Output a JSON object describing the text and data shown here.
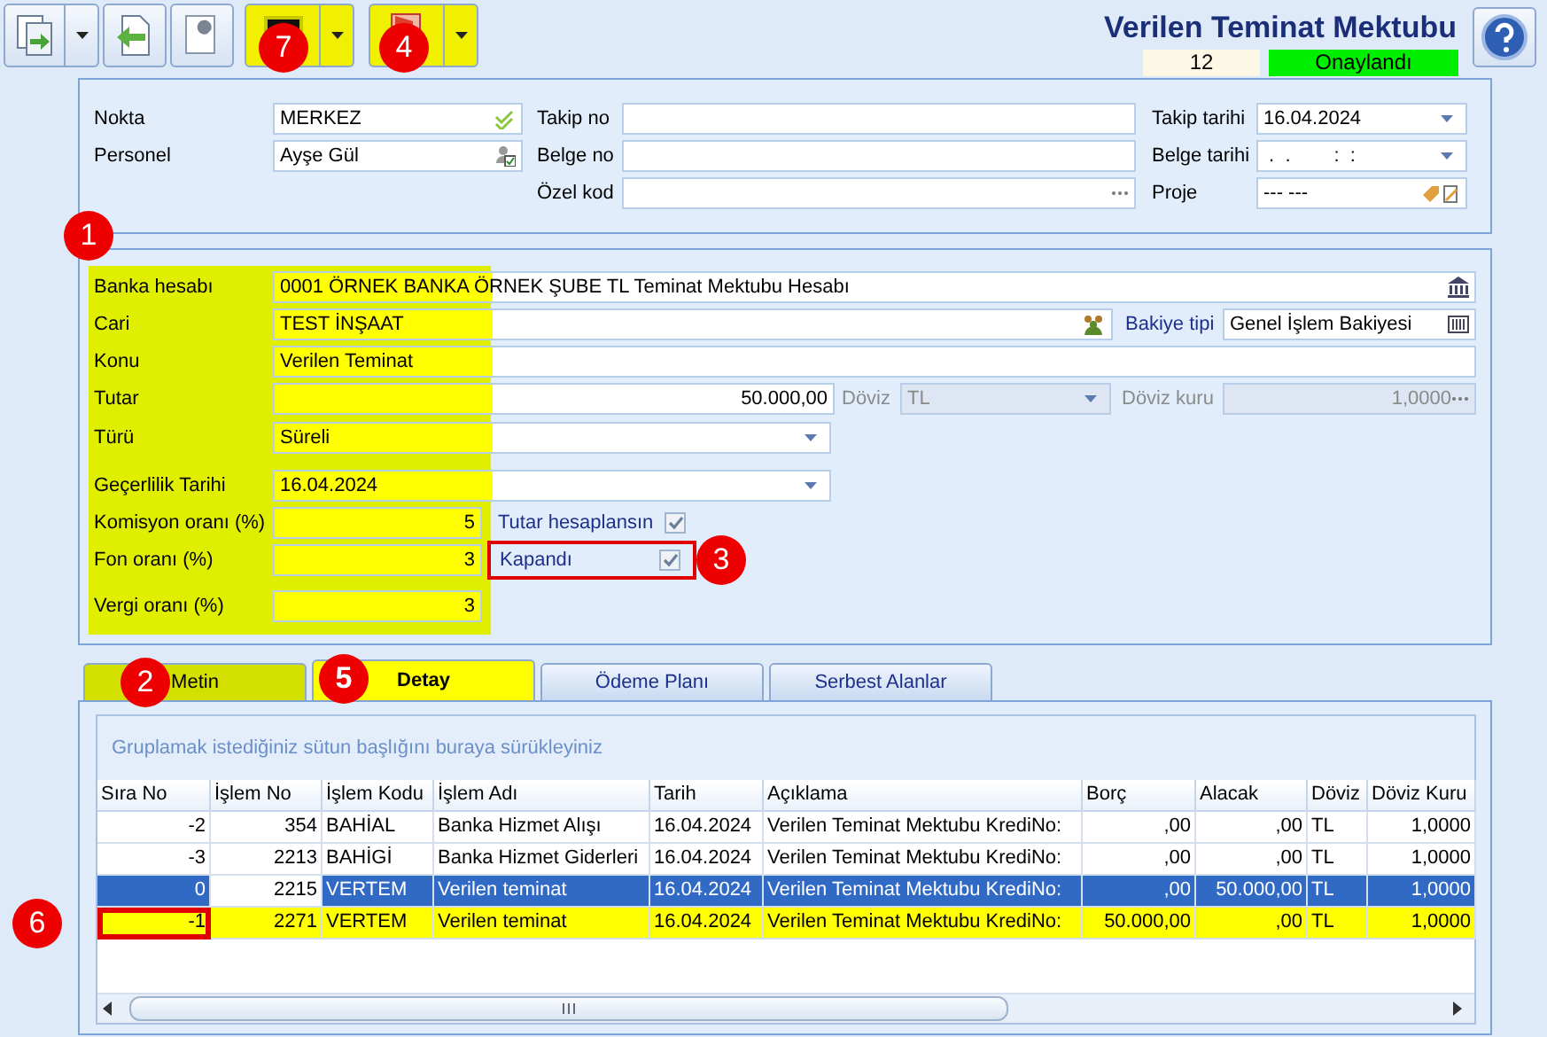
{
  "toolbar": {
    "buttons": [
      {
        "kind": "split",
        "highlighted": false
      },
      {
        "kind": "plain",
        "highlighted": false
      },
      {
        "kind": "plain",
        "highlighted": false
      },
      {
        "kind": "split",
        "highlighted": true,
        "badge": "7"
      },
      {
        "kind": "split",
        "highlighted": true,
        "badge": "4"
      }
    ]
  },
  "document": {
    "title": "Verilen Teminat Mektubu",
    "number": "12",
    "status": "Onaylandı"
  },
  "header_form": {
    "nokta": {
      "label": "Nokta",
      "value": "MERKEZ"
    },
    "personel": {
      "label": "Personel",
      "value": "Ayşe Gül"
    },
    "takip_no": {
      "label": "Takip no"
    },
    "belge_no": {
      "label": "Belge no"
    },
    "ozel_kod": {
      "label": "Özel kod"
    },
    "takip_tarihi": {
      "label": "Takip tarihi",
      "value": "16.04.2024"
    },
    "belge_tarihi": {
      "label": "Belge tarihi",
      "value": " .  .        :  :"
    },
    "proje": {
      "label": "Proje",
      "value": "--- ---"
    }
  },
  "main_form": {
    "highlighted": true,
    "badge": "1",
    "banka_hesabi": {
      "label": "Banka hesabı",
      "value": "0001 ÖRNEK BANKA ÖRNEK ŞUBE TL Teminat Mektubu Hesabı"
    },
    "cari": {
      "label": "Cari",
      "value": "TEST İNŞAAT"
    },
    "bakiye_tipi": {
      "label": "Bakiye tipi",
      "value": "Genel İşlem Bakiyesi"
    },
    "konu": {
      "label": "Konu",
      "value": "Verilen Teminat"
    },
    "tutar": {
      "label": "Tutar",
      "value": "50.000,00"
    },
    "doviz": {
      "label": "Döviz",
      "value": "TL",
      "disabled": true
    },
    "doviz_kuru": {
      "label": "Döviz kuru",
      "value": "1,0000",
      "disabled": true
    },
    "turu": {
      "label": "Türü",
      "value": "Süreli"
    },
    "gecerlilik_tarihi": {
      "label": "Geçerlilik Tarihi",
      "value": "16.04.2024"
    },
    "komisyon_orani": {
      "label": "Komisyon oranı (%)",
      "value": "5"
    },
    "tutar_hesaplansin": {
      "label": "Tutar hesaplansın",
      "checked": true
    },
    "fon_orani": {
      "label": "Fon oranı (%)",
      "value": "3"
    },
    "kapandi": {
      "label": "Kapandı",
      "checked": true,
      "outlined": true,
      "badge": "3"
    },
    "vergi_orani": {
      "label": "Vergi oranı (%)",
      "value": "3"
    }
  },
  "tabs": [
    {
      "label": "Metin",
      "selected": false,
      "color": "#d4e000",
      "badge": "2"
    },
    {
      "label": "Detay",
      "selected": true,
      "color": "#ffff00",
      "badge": "5"
    },
    {
      "label": "Ödeme Planı",
      "selected": false
    },
    {
      "label": "Serbest Alanlar",
      "selected": false
    }
  ],
  "grid": {
    "group_hint": "Gruplamak istediğiniz sütun başlığını buraya sürükleyiniz",
    "columns": [
      {
        "label": "Sıra No",
        "kind": "number"
      },
      {
        "label": "İşlem No",
        "kind": "number"
      },
      {
        "label": "İşlem Kodu",
        "kind": "text"
      },
      {
        "label": "İşlem Adı",
        "kind": "text"
      },
      {
        "label": "Tarih",
        "kind": "text"
      },
      {
        "label": "Açıklama",
        "kind": "text"
      },
      {
        "label": "Borç",
        "kind": "number"
      },
      {
        "label": "Alacak",
        "kind": "number"
      },
      {
        "label": "Döviz",
        "kind": "text"
      },
      {
        "label": "Döviz Kuru",
        "kind": "number"
      }
    ],
    "rows": [
      {
        "selected": false,
        "highlighted": false,
        "cells": [
          "-2",
          "354",
          "BAHİAL",
          "Banka Hizmet Alışı",
          "16.04.2024",
          "Verilen Teminat Mektubu KrediNo:",
          ",00",
          ",00",
          "TL",
          "1,0000"
        ]
      },
      {
        "selected": false,
        "highlighted": false,
        "cells": [
          "-3",
          "2213",
          "BAHİGİ",
          "Banka Hizmet Giderleri",
          "16.04.2024",
          "Verilen Teminat Mektubu KrediNo:",
          ",00",
          ",00",
          "TL",
          "1,0000"
        ]
      },
      {
        "selected": true,
        "highlighted": false,
        "cells": [
          "0",
          "2215",
          "VERTEM",
          "Verilen teminat",
          "16.04.2024",
          "Verilen Teminat Mektubu KrediNo:",
          ",00",
          "50.000,00",
          "TL",
          "1,0000"
        ]
      },
      {
        "selected": false,
        "highlighted": true,
        "badge": "6",
        "cells": [
          "-1",
          "2271",
          "VERTEM",
          "Verilen teminat",
          "16.04.2024",
          "Verilen Teminat Mektubu KrediNo:",
          "50.000,00",
          ",00",
          "TL",
          "1,0000"
        ]
      }
    ]
  }
}
